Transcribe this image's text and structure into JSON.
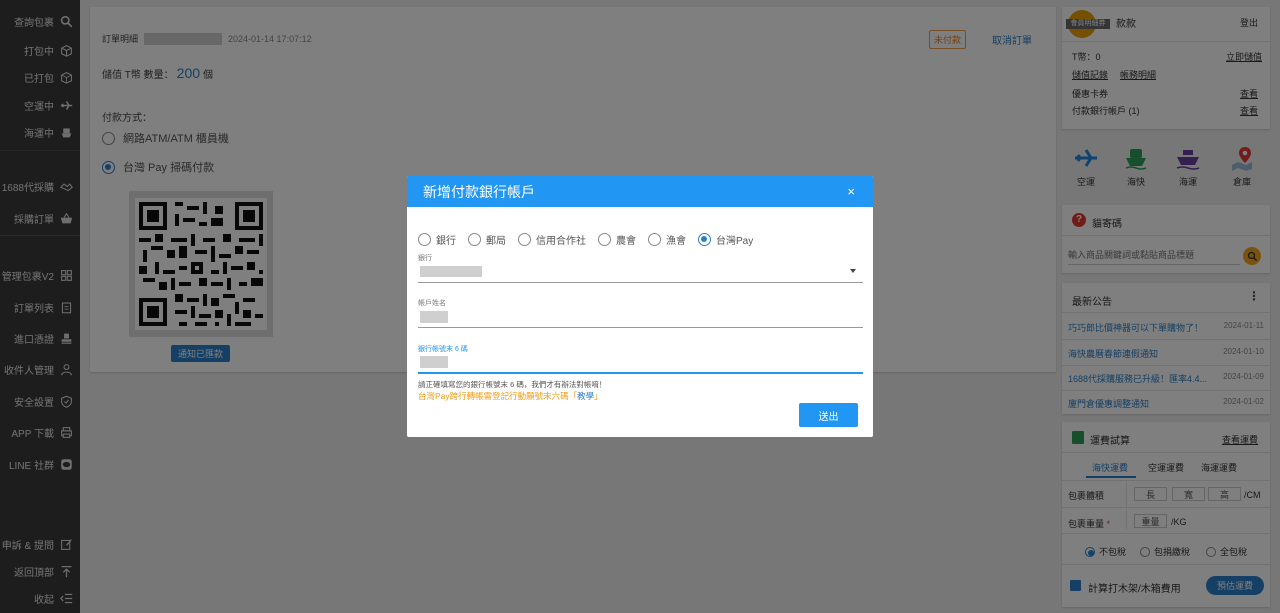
{
  "sidebar": {
    "items": [
      {
        "label": "查詢包裹",
        "icon": "search-icon"
      },
      {
        "label": "打包中",
        "icon": "box-open-icon"
      },
      {
        "label": "已打包",
        "icon": "box-icon"
      },
      {
        "label": "空運中",
        "icon": "plane-icon"
      },
      {
        "label": "海運中",
        "icon": "ship-icon"
      },
      {
        "label": "1688代採購",
        "icon": "handshake-icon"
      },
      {
        "label": "採購訂單",
        "icon": "basket-icon"
      },
      {
        "label": "管理包裹V2",
        "icon": "grid-icon"
      },
      {
        "label": "訂單列表",
        "icon": "clipboard-icon"
      },
      {
        "label": "進口憑證",
        "icon": "stamp-icon"
      },
      {
        "label": "收件人管理",
        "icon": "user-icon"
      },
      {
        "label": "安全設置",
        "icon": "shield-icon"
      },
      {
        "label": "APP 下載",
        "icon": "printer-icon"
      },
      {
        "label": "LINE 社群",
        "icon": "line-icon"
      },
      {
        "label": "申訴 & 提問",
        "icon": "edit-icon"
      },
      {
        "label": "返回頂部",
        "icon": "arrow-up-icon"
      },
      {
        "label": "收起",
        "icon": "collapse-icon"
      }
    ]
  },
  "order": {
    "label": "訂單明細",
    "time": "2024-01-14 17:07:12",
    "status": "未付款",
    "cancel": "取消訂單",
    "qty_prefix": "儲值 T幣 數量：",
    "qty_value": "200",
    "qty_unit": "個",
    "pay_title": "付款方式：",
    "pay_options": [
      "網路ATM/ATM 櫃員機",
      "台灣 Pay 掃碼付款"
    ],
    "notify_button": "通知已匯款"
  },
  "account": {
    "badge": "會員明細券",
    "title": "款款",
    "logout": "登出",
    "tcoin_label": "T幣：0",
    "tcoin_link": "立即儲值",
    "links": [
      "儲值記錄",
      "帳務明細"
    ],
    "coupon_label": "優惠卡券",
    "coupon_link": "查看",
    "bank_label": "付款銀行帳戶 (1)",
    "bank_link": "查看"
  },
  "shipping_modes": [
    {
      "label": "空運",
      "icon": "plane-icon",
      "color": "#1e88e5"
    },
    {
      "label": "海快",
      "icon": "ferry-icon",
      "color": "#2e9e5b"
    },
    {
      "label": "海運",
      "icon": "cargo-ship-icon",
      "color": "#6a3fa0"
    },
    {
      "label": "倉庫",
      "icon": "map-pin-icon",
      "color": "#e53935"
    }
  ],
  "search": {
    "title": "貓寄碼",
    "placeholder": "輸入商品關鍵詞或黏貼商品標題"
  },
  "news": {
    "title": "最新公告",
    "items": [
      {
        "title": "巧巧郎比價神器可以下單購物了！",
        "date": "2024-01-11"
      },
      {
        "title": "海快農曆春節連假通知",
        "date": "2024-01-10"
      },
      {
        "title": "1688代採購服務已升級！匯率4.4...",
        "date": "2024-01-09"
      },
      {
        "title": "廈門倉優惠調整通知",
        "date": "2024-01-02"
      }
    ]
  },
  "calculator": {
    "title": "運費試算",
    "link": "查看運費",
    "tabs": [
      "海快運費",
      "空運運費",
      "海運運費"
    ],
    "volume_label": "包裹體積",
    "dims": [
      "長",
      "寬",
      "高"
    ],
    "volume_unit": "/CM",
    "weight_label": "包裹重量",
    "weight_placeholder": "重量",
    "weight_unit": "/KG",
    "tax_options": [
      "不包稅",
      "包捐繳稅",
      "全包稅"
    ],
    "wood_label": "計算打木架/木箱費用",
    "estimate_button": "預估運費"
  },
  "modal": {
    "title": "新增付款銀行帳戶",
    "close": "×",
    "bank_types": [
      "銀行",
      "郵局",
      "信用合作社",
      "農會",
      "漁會",
      "台灣Pay"
    ],
    "bank_label": "銀行",
    "name_label": "帳戶姓名",
    "account_label": "銀行帳號末 6 碼",
    "hint": "請正確填寫您的銀行帳號末 6 碼，我們才有辦法對帳唷！",
    "hint2_prefix": "台灣Pay跨行轉帳需登記行動願號末六碼「",
    "hint2_link": "教學",
    "hint2_suffix": "」",
    "submit": "送出"
  },
  "colors": {
    "accent": "#2196f3",
    "sidebar_bg": "#3a3a3a",
    "warning": "#f39c12"
  }
}
